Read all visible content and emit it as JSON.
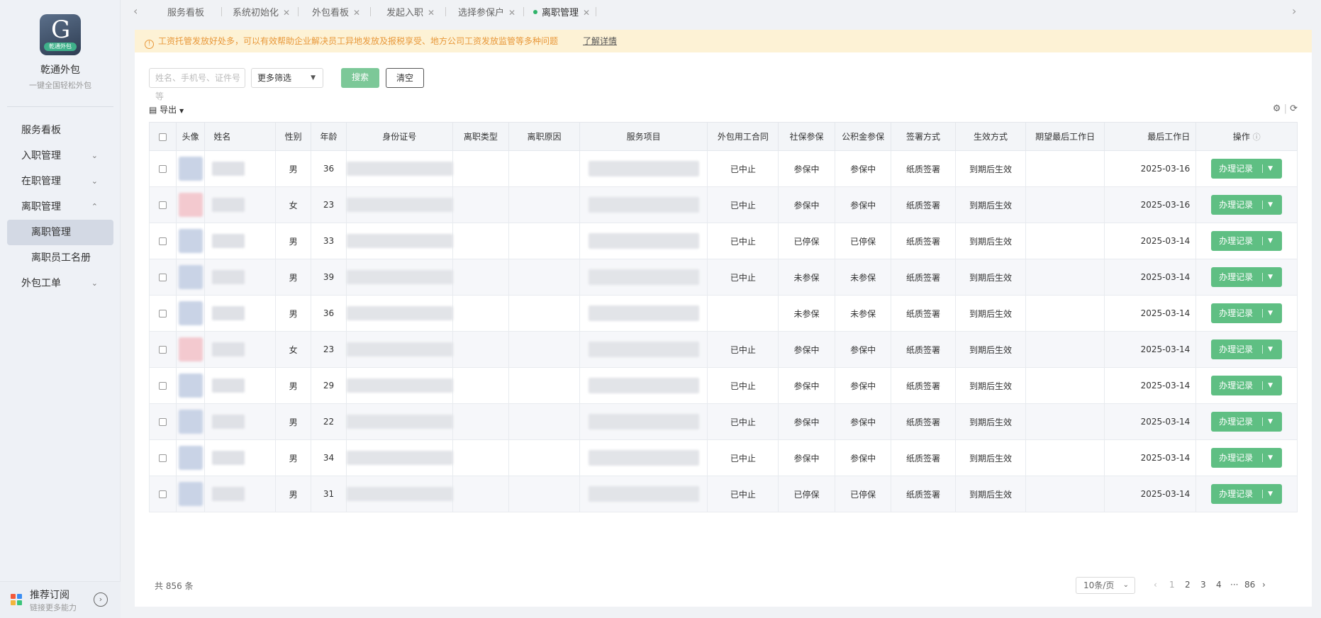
{
  "sidebar": {
    "logo_caption": "乾通外包",
    "brand": "乾通外包",
    "slogan": "一键全国轻松外包",
    "nav": [
      {
        "label": "服务看板"
      },
      {
        "label": "入职管理"
      },
      {
        "label": "在职管理"
      },
      {
        "label": "离职管理"
      },
      {
        "label": "离职管理"
      },
      {
        "label": "离职员工名册"
      },
      {
        "label": "外包工单"
      }
    ],
    "bottom": {
      "title": "推荐订阅",
      "subtitle": "链接更多能力"
    }
  },
  "tabs": [
    {
      "label": "服务看板"
    },
    {
      "label": "系统初始化"
    },
    {
      "label": "外包看板"
    },
    {
      "label": "发起入职"
    },
    {
      "label": "选择参保户"
    },
    {
      "label": "离职管理"
    }
  ],
  "notice": {
    "text": "工资托管发放好处多，可以有效帮助企业解决员工异地发放及报税享受、地方公司工资发放监管等多种问题",
    "link": "了解详情"
  },
  "filters": {
    "search_placeholder": "姓名、手机号、证件号等",
    "more_filter": "更多筛选",
    "search_button": "搜索",
    "clear_button": "清空"
  },
  "toolbar": {
    "export_label": "导出"
  },
  "table": {
    "headers": {
      "avatar": "头像",
      "name": "姓名",
      "gender": "性别",
      "age": "年龄",
      "id": "身份证号",
      "resign_type": "离职类型",
      "resign_reason": "离职原因",
      "service": "服务项目",
      "contract": "外包用工合同",
      "social": "社保参保",
      "fund": "公积金参保",
      "sign": "签署方式",
      "effect": "生效方式",
      "expected": "期望最后工作日",
      "last_day": "最后工作日",
      "ops": "操作"
    },
    "op_label": "办理记录",
    "rows": [
      {
        "gender": "男",
        "age": "36",
        "contract": "已中止",
        "social": "参保中",
        "fund": "参保中",
        "sign": "纸质签署",
        "effect": "到期后生效",
        "last_day": "2025-03-16",
        "avatar_color": "#c9d3e6"
      },
      {
        "gender": "女",
        "age": "23",
        "contract": "已中止",
        "social": "参保中",
        "fund": "参保中",
        "sign": "纸质签署",
        "effect": "到期后生效",
        "last_day": "2025-03-16",
        "avatar_color": "#f3c9cf"
      },
      {
        "gender": "男",
        "age": "33",
        "contract": "已中止",
        "social": "已停保",
        "fund": "已停保",
        "sign": "纸质签署",
        "effect": "到期后生效",
        "last_day": "2025-03-14",
        "avatar_color": "#c9d3e6"
      },
      {
        "gender": "男",
        "age": "39",
        "contract": "已中止",
        "social": "未参保",
        "fund": "未参保",
        "sign": "纸质签署",
        "effect": "到期后生效",
        "last_day": "2025-03-14",
        "avatar_color": "#c9d3e6"
      },
      {
        "gender": "男",
        "age": "36",
        "contract": "",
        "social": "未参保",
        "fund": "未参保",
        "sign": "纸质签署",
        "effect": "到期后生效",
        "last_day": "2025-03-14",
        "avatar_color": "#c9d3e6"
      },
      {
        "gender": "女",
        "age": "23",
        "contract": "已中止",
        "social": "参保中",
        "fund": "参保中",
        "sign": "纸质签署",
        "effect": "到期后生效",
        "last_day": "2025-03-14",
        "avatar_color": "#f3c9cf"
      },
      {
        "gender": "男",
        "age": "29",
        "contract": "已中止",
        "social": "参保中",
        "fund": "参保中",
        "sign": "纸质签署",
        "effect": "到期后生效",
        "last_day": "2025-03-14",
        "avatar_color": "#c9d3e6"
      },
      {
        "gender": "男",
        "age": "22",
        "contract": "已中止",
        "social": "参保中",
        "fund": "参保中",
        "sign": "纸质签署",
        "effect": "到期后生效",
        "last_day": "2025-03-14",
        "avatar_color": "#c9d3e6"
      },
      {
        "gender": "男",
        "age": "34",
        "contract": "已中止",
        "social": "参保中",
        "fund": "参保中",
        "sign": "纸质签署",
        "effect": "到期后生效",
        "last_day": "2025-03-14",
        "avatar_color": "#c9d3e6"
      },
      {
        "gender": "男",
        "age": "31",
        "contract": "已中止",
        "social": "已停保",
        "fund": "已停保",
        "sign": "纸质签署",
        "effect": "到期后生效",
        "last_day": "2025-03-14",
        "avatar_color": "#c9d3e6"
      }
    ]
  },
  "pagination": {
    "total": "共 856 条",
    "page_size": "10条/页",
    "pages": [
      "1",
      "2",
      "3",
      "4",
      "···",
      "86"
    ]
  },
  "colors": {
    "accent": "#5fbf83",
    "notice_bg": "#fdf2d5",
    "notice_text": "#e8983a",
    "active_nav": "#d3d9e4"
  }
}
